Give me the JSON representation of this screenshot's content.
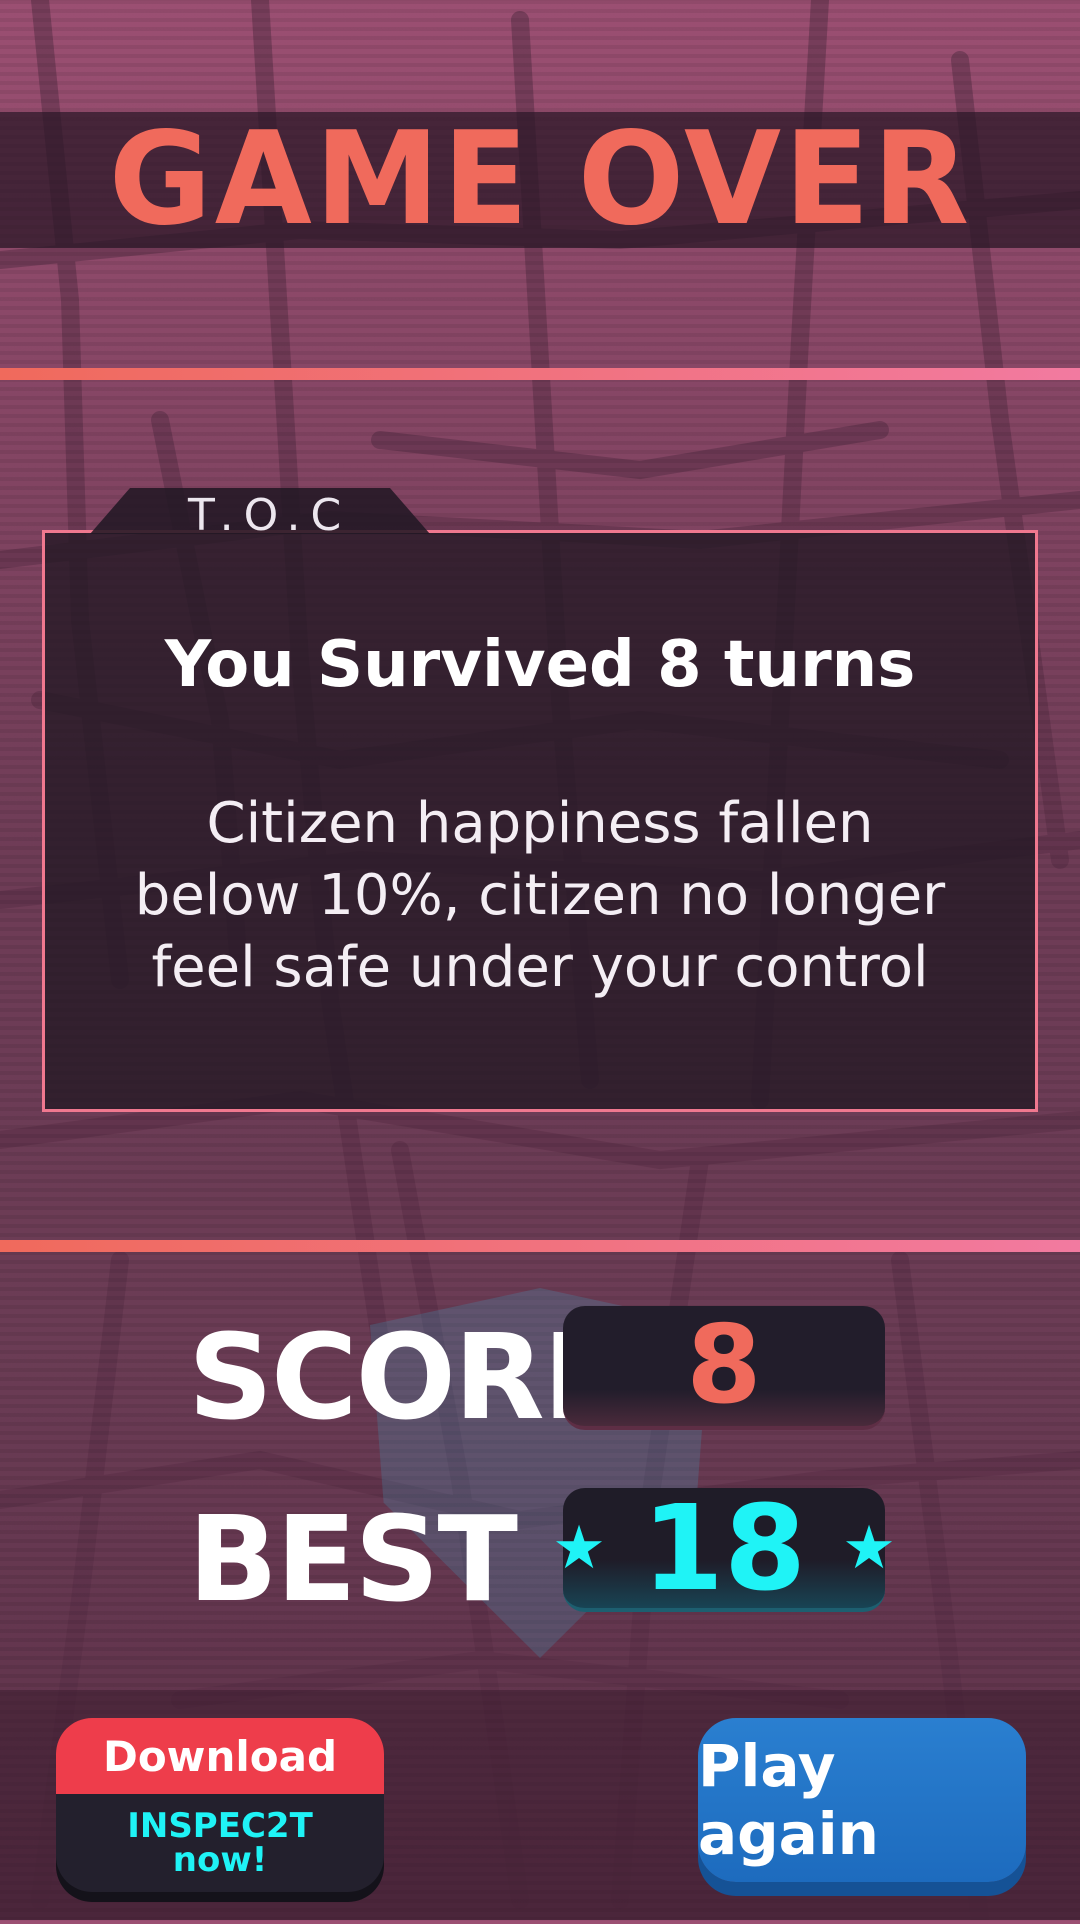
{
  "title": "GAME OVER",
  "panel": {
    "tab_label": "T.O.C",
    "headline": "You Survived 8 turns",
    "message": "Citizen happiness fallen below 10%, citizen no longer feel safe under your control"
  },
  "stats": {
    "score_label": "SCORE",
    "score_value": "8",
    "best_label": "BEST",
    "best_value": "18"
  },
  "buttons": {
    "download_top": "Download",
    "download_line1": "INSPEC2T",
    "download_line2": "now!",
    "play_again": "Play again"
  },
  "colors": {
    "accent": "#f06a5c",
    "best": "#1ff3f6",
    "download": "#ee3d4b",
    "play": "#2277c8"
  },
  "icons": [
    "star-icon",
    "shield-emblem"
  ]
}
